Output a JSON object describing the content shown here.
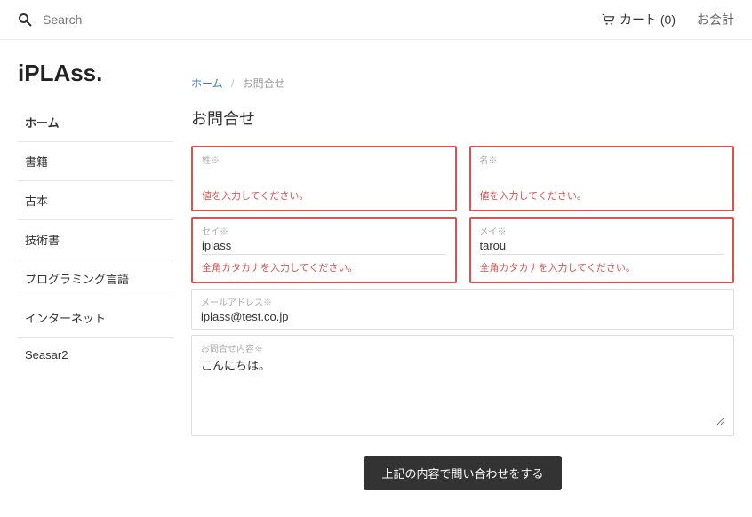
{
  "header": {
    "search_placeholder": "Search",
    "cart_label": "カート (0)",
    "checkout_label": "お会計"
  },
  "brand": "iPLAss.",
  "sidebar": {
    "items": [
      {
        "label": "ホーム"
      },
      {
        "label": "書籍"
      },
      {
        "label": "古本"
      },
      {
        "label": "技術書"
      },
      {
        "label": "プログラミング言語"
      },
      {
        "label": "インターネット"
      },
      {
        "label": "Seasar2"
      }
    ]
  },
  "breadcrumb": {
    "home": "ホーム",
    "sep": "/",
    "current": "お問合せ"
  },
  "page_title": "お問合せ",
  "form": {
    "sei_label": "姓※",
    "sei_value": "",
    "sei_error": "値を入力してください。",
    "mei_label": "名※",
    "mei_value": "",
    "mei_error": "値を入力してください。",
    "sei_kana_label": "セイ※",
    "sei_kana_value": "iplass",
    "sei_kana_error": "全角カタカナを入力してください。",
    "mei_kana_label": "メイ※",
    "mei_kana_value": "tarou",
    "mei_kana_error": "全角カタカナを入力してください。",
    "email_label": "メールアドレス※",
    "email_value": "iplass@test.co.jp",
    "content_label": "お問合せ内容※",
    "content_value": "こんにちは。",
    "submit_label": "上記の内容で問い合わせをする"
  }
}
